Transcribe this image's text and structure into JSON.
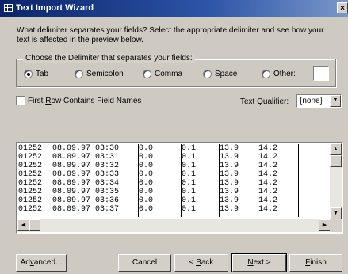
{
  "window": {
    "title": "Text Import Wizard",
    "close_glyph": "×"
  },
  "prompt": "What delimiter separates your fields?  Select the appropriate delimiter and see how your text is affected in the preview below.",
  "delimiter_group": {
    "legend": "Choose the Delimiter that separates your fields:",
    "options": [
      {
        "label": "Tab",
        "checked": true
      },
      {
        "label": "Semicolon",
        "checked": false
      },
      {
        "label": "Comma",
        "checked": false
      },
      {
        "label": "Space",
        "checked": false
      },
      {
        "label": "Other:",
        "checked": false
      }
    ],
    "other_value": ""
  },
  "first_row": {
    "label_pre": "First ",
    "label_u": "R",
    "label_post": "ow Contains Field Names",
    "checked": false
  },
  "qualifier": {
    "label_pre": "Text ",
    "label_u": "Q",
    "label_post": "ualifier:",
    "value": "{none}"
  },
  "preview": {
    "columns": 7,
    "rows": [
      [
        "01252",
        "08.09.97 03:30",
        "0.0",
        "0.1",
        "13.9",
        "14.2",
        ""
      ],
      [
        "01252",
        "08.09.97 03:31",
        "0.0",
        "0.1",
        "13.9",
        "14.2",
        ""
      ],
      [
        "01252",
        "08.09.97 03:32",
        "0.0",
        "0.1",
        "13.9",
        "14.2",
        ""
      ],
      [
        "01252",
        "08.09.97 03:33",
        "0.0",
        "0.1",
        "13.9",
        "14.2",
        ""
      ],
      [
        "01252",
        "08.09.97 03:34",
        "0.0",
        "0.1",
        "13.9",
        "14.2",
        ""
      ],
      [
        "01252",
        "08.09.97 03:35",
        "0.0",
        "0.1",
        "13.9",
        "14.2",
        ""
      ],
      [
        "01252",
        "08.09.97 03:36",
        "0.0",
        "0.1",
        "13.9",
        "14.2",
        ""
      ],
      [
        "01252",
        "08.09.97 03:37",
        "0.0",
        "0.1",
        "13.9",
        "14.2",
        ""
      ]
    ]
  },
  "buttons": {
    "advanced": {
      "pre": "Ad",
      "u": "v",
      "post": "anced..."
    },
    "cancel": "Cancel",
    "back": {
      "pre": "< ",
      "u": "B",
      "post": "ack"
    },
    "next": {
      "pre": "",
      "u": "N",
      "post": "ext >"
    },
    "finish": {
      "pre": "",
      "u": "F",
      "post": "inish"
    }
  },
  "icons": {
    "scroll_up": "▲",
    "scroll_down": "▼",
    "scroll_left": "◀",
    "scroll_right": "▶",
    "dropdown": "▼"
  }
}
